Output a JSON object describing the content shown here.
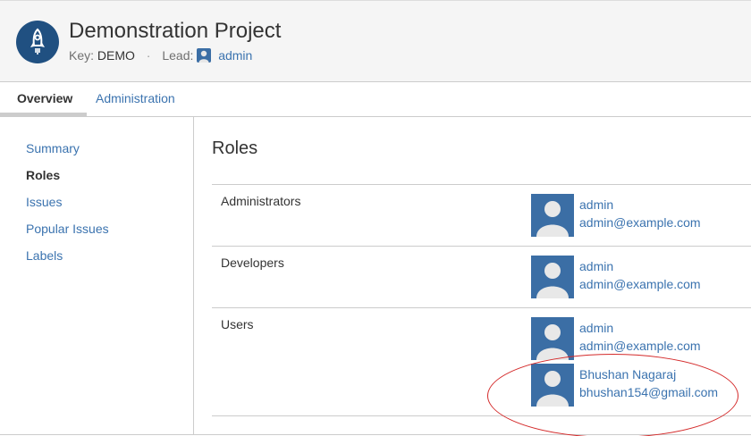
{
  "project": {
    "title": "Demonstration Project",
    "key_label": "Key:",
    "key_value": "DEMO",
    "separator": "·",
    "lead_label": "Lead:",
    "lead_name": "admin",
    "avatar_icon": "rocket-icon"
  },
  "tabs": [
    {
      "label": "Overview",
      "active": true
    },
    {
      "label": "Administration",
      "active": false
    }
  ],
  "sidebar": {
    "items": [
      {
        "label": "Summary",
        "active": false
      },
      {
        "label": "Roles",
        "active": true
      },
      {
        "label": "Issues",
        "active": false
      },
      {
        "label": "Popular Issues",
        "active": false
      },
      {
        "label": "Labels",
        "active": false
      }
    ]
  },
  "main": {
    "title": "Roles",
    "roles": [
      {
        "name": "Administrators",
        "users": [
          {
            "name": "admin",
            "email": "admin@example.com"
          }
        ]
      },
      {
        "name": "Developers",
        "users": [
          {
            "name": "admin",
            "email": "admin@example.com"
          }
        ]
      },
      {
        "name": "Users",
        "users": [
          {
            "name": "admin",
            "email": "admin@example.com"
          },
          {
            "name": "Bhushan Nagaraj",
            "email": "bhushan154@gmail.com"
          }
        ]
      }
    ]
  },
  "colors": {
    "link": "#3b73af",
    "project_avatar_bg": "#205081",
    "highlight": "#d42a2a"
  }
}
